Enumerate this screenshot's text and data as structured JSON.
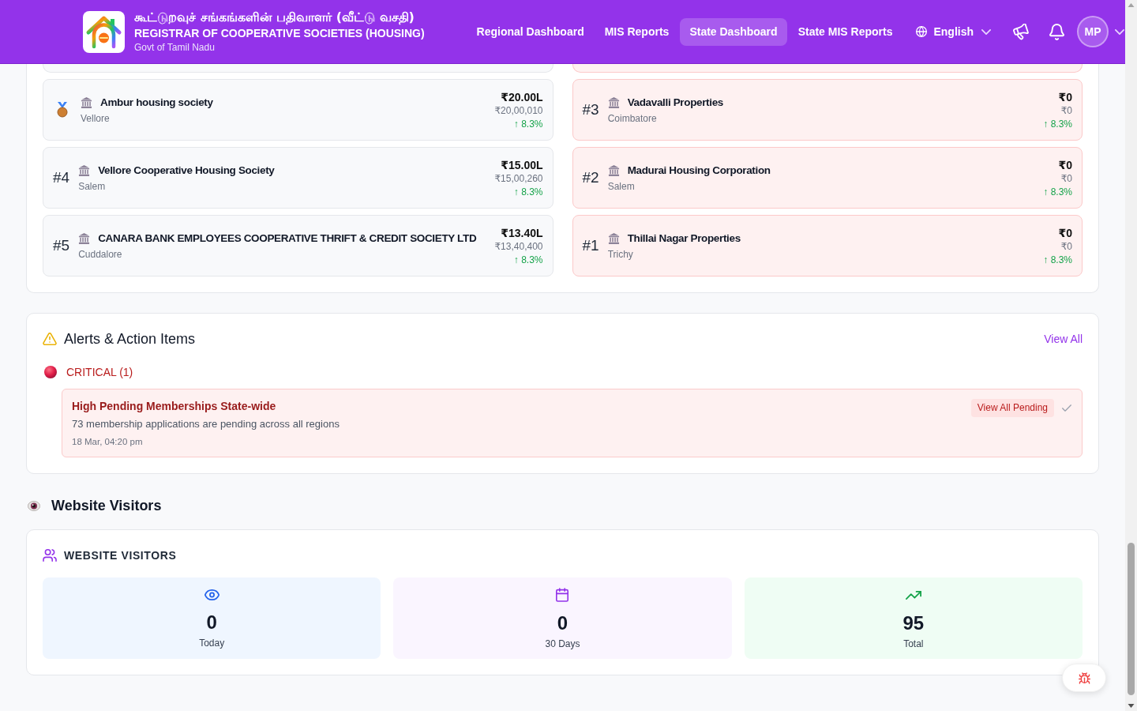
{
  "header": {
    "title_tamil": "கூட்டுறவுச் சங்கங்களின் பதிவாளர் (வீட்டு வசதி)",
    "title": "REGISTRAR OF COOPERATIVE SOCIETIES (HOUSING)",
    "subtitle": "Govt of Tamil Nadu",
    "nav": [
      {
        "label": "Regional Dashboard",
        "selected": false
      },
      {
        "label": "MIS Reports",
        "selected": false
      },
      {
        "label": "State Dashboard",
        "selected": true
      },
      {
        "label": "State MIS Reports",
        "selected": false
      }
    ],
    "language": "English",
    "avatar": "MP"
  },
  "rankings": {
    "columns": [
      {
        "kind": "top",
        "items": [
          {
            "kind": "medal",
            "name": "Ambur housing society",
            "location": "Vellore",
            "amount": "₹20.00L",
            "exact": "₹20,00,010",
            "growth": "↑ 8.3%"
          },
          {
            "kind": "rank",
            "rank": "#4",
            "name": "Vellore Cooperative Housing Society",
            "location": "Salem",
            "amount": "₹15.00L",
            "exact": "₹15,00,260",
            "growth": "↑ 8.3%"
          },
          {
            "kind": "rank",
            "rank": "#5",
            "name": "CANARA BANK EMPLOYEES COOPERATIVE THRIFT & CREDIT SOCIETY LTD",
            "location": "Cuddalore",
            "amount": "₹13.40L",
            "exact": "₹13,40,400",
            "growth": "↑ 8.3%"
          }
        ]
      },
      {
        "kind": "low",
        "items": [
          {
            "kind": "rank",
            "rank": "#3",
            "name": "Vadavalli Properties",
            "location": "Coimbatore",
            "amount": "₹0",
            "exact": "₹0",
            "growth": "↑ 8.3%"
          },
          {
            "kind": "rank",
            "rank": "#2",
            "name": "Madurai Housing Corporation",
            "location": "Salem",
            "amount": "₹0",
            "exact": "₹0",
            "growth": "↑ 8.3%"
          },
          {
            "kind": "rank",
            "rank": "#1",
            "name": "Thillai Nagar Properties",
            "location": "Trichy",
            "amount": "₹0",
            "exact": "₹0",
            "growth": "↑ 8.3%"
          }
        ]
      }
    ]
  },
  "alerts": {
    "title": "Alerts & Action Items",
    "view_all": "View All",
    "groups": [
      {
        "kind": "critical",
        "label": "CRITICAL (1)",
        "items": [
          {
            "title": "High Pending Memberships State-wide",
            "description": "73 membership applications are pending across all regions",
            "time": "18 Mar, 04:20 pm",
            "action": "View All Pending"
          }
        ]
      }
    ]
  },
  "visitors": {
    "section_title": "Website Visitors",
    "card_title": "WEBSITE VISITORS",
    "stats": [
      {
        "kind": "today",
        "value": "0",
        "label": "Today"
      },
      {
        "kind": "month",
        "value": "0",
        "label": "30 Days"
      },
      {
        "kind": "total",
        "value": "95",
        "label": "Total"
      }
    ]
  }
}
